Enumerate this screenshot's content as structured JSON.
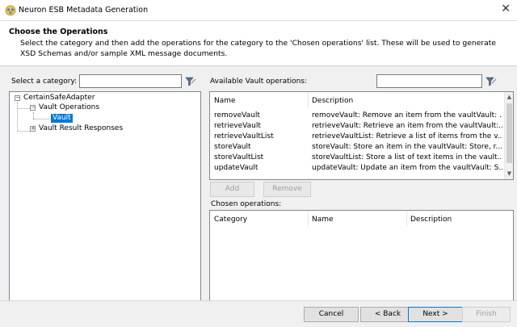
{
  "window": {
    "title": "Neuron ESB Metadata Generation",
    "close_glyph": "✕",
    "app_icon": "neuron-app-icon"
  },
  "header": {
    "title": "Choose the Operations",
    "description": "Select the category and then add the operations for the category to the 'Chosen operations' list. These will be used to generate XSD Schemas and/or sample XML message documents."
  },
  "category": {
    "label": "Select a category:",
    "search_value": "",
    "filter_icon": "funnel-icon"
  },
  "tree": {
    "root": "CertainSafeAdapter",
    "nodes": [
      "Vault Operations",
      "Vault",
      "Vault Result Responses"
    ],
    "selected": "Vault",
    "expand_glyphs": {
      "expanded": "−",
      "collapsed": "+"
    }
  },
  "available": {
    "label": "Available Vault operations:",
    "search_value": "",
    "columns": [
      "Name",
      "Description"
    ],
    "rows": [
      {
        "name": "removeVault",
        "description": "removeVault: Remove an item from the vaultVault: ..."
      },
      {
        "name": "retrieveVault",
        "description": "retrieveVault: Retrieve an item from the vaultVault:..."
      },
      {
        "name": "retrieveVaultList",
        "description": "retrieveVaultList: Retrieve a list of items from the v..."
      },
      {
        "name": "storeVault",
        "description": "storeVault: Store an item in the vaultVault: Store, r..."
      },
      {
        "name": "storeVaultList",
        "description": "storeVaultList: Store a list of text items in the vault..."
      },
      {
        "name": "updateVault",
        "description": "updateVault: Update an item from the vaultVault: S..."
      }
    ],
    "scroll_up": "▲",
    "scroll_down": "▼"
  },
  "actions": {
    "add": "Add",
    "remove": "Remove"
  },
  "chosen": {
    "label": "Chosen operations:",
    "columns": [
      "Category",
      "Name",
      "Description"
    ]
  },
  "footer": {
    "cancel": "Cancel",
    "back": "< Back",
    "next": "Next >",
    "finish": "Finish"
  },
  "colors": {
    "selection": "#0078d7",
    "border": "#828790",
    "disabled_text": "#a0a0a0"
  }
}
